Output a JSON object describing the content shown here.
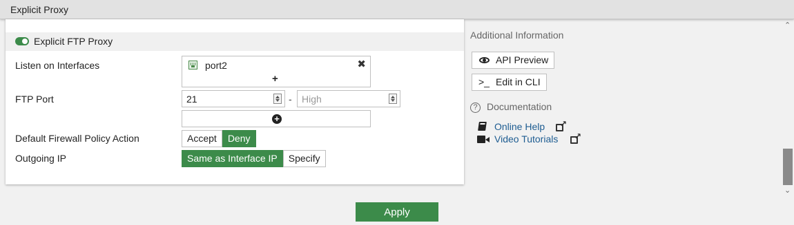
{
  "header": {
    "title": "Explicit Proxy"
  },
  "section": {
    "title": "Explicit FTP Proxy",
    "enabled": true
  },
  "form": {
    "listen_interfaces": {
      "label": "Listen on Interfaces",
      "items": [
        "port2"
      ],
      "add": "+"
    },
    "ftp_port": {
      "label": "FTP Port",
      "low": "21",
      "separator": "-",
      "high_placeholder": "High"
    },
    "default_policy": {
      "label": "Default Firewall Policy Action",
      "options": [
        "Accept",
        "Deny"
      ],
      "selected": "Deny"
    },
    "outgoing_ip": {
      "label": "Outgoing IP",
      "options": [
        "Same as Interface IP",
        "Specify"
      ],
      "selected": "Same as Interface IP"
    }
  },
  "sidebar": {
    "title": "Additional Information",
    "api_preview": "API Preview",
    "edit_cli": "Edit in CLI",
    "documentation": "Documentation",
    "online_help": "Online Help",
    "video_tutorials": "Video Tutorials"
  },
  "footer": {
    "apply": "Apply"
  },
  "colors": {
    "accent": "#3c8b4a",
    "link": "#1d5c91"
  }
}
